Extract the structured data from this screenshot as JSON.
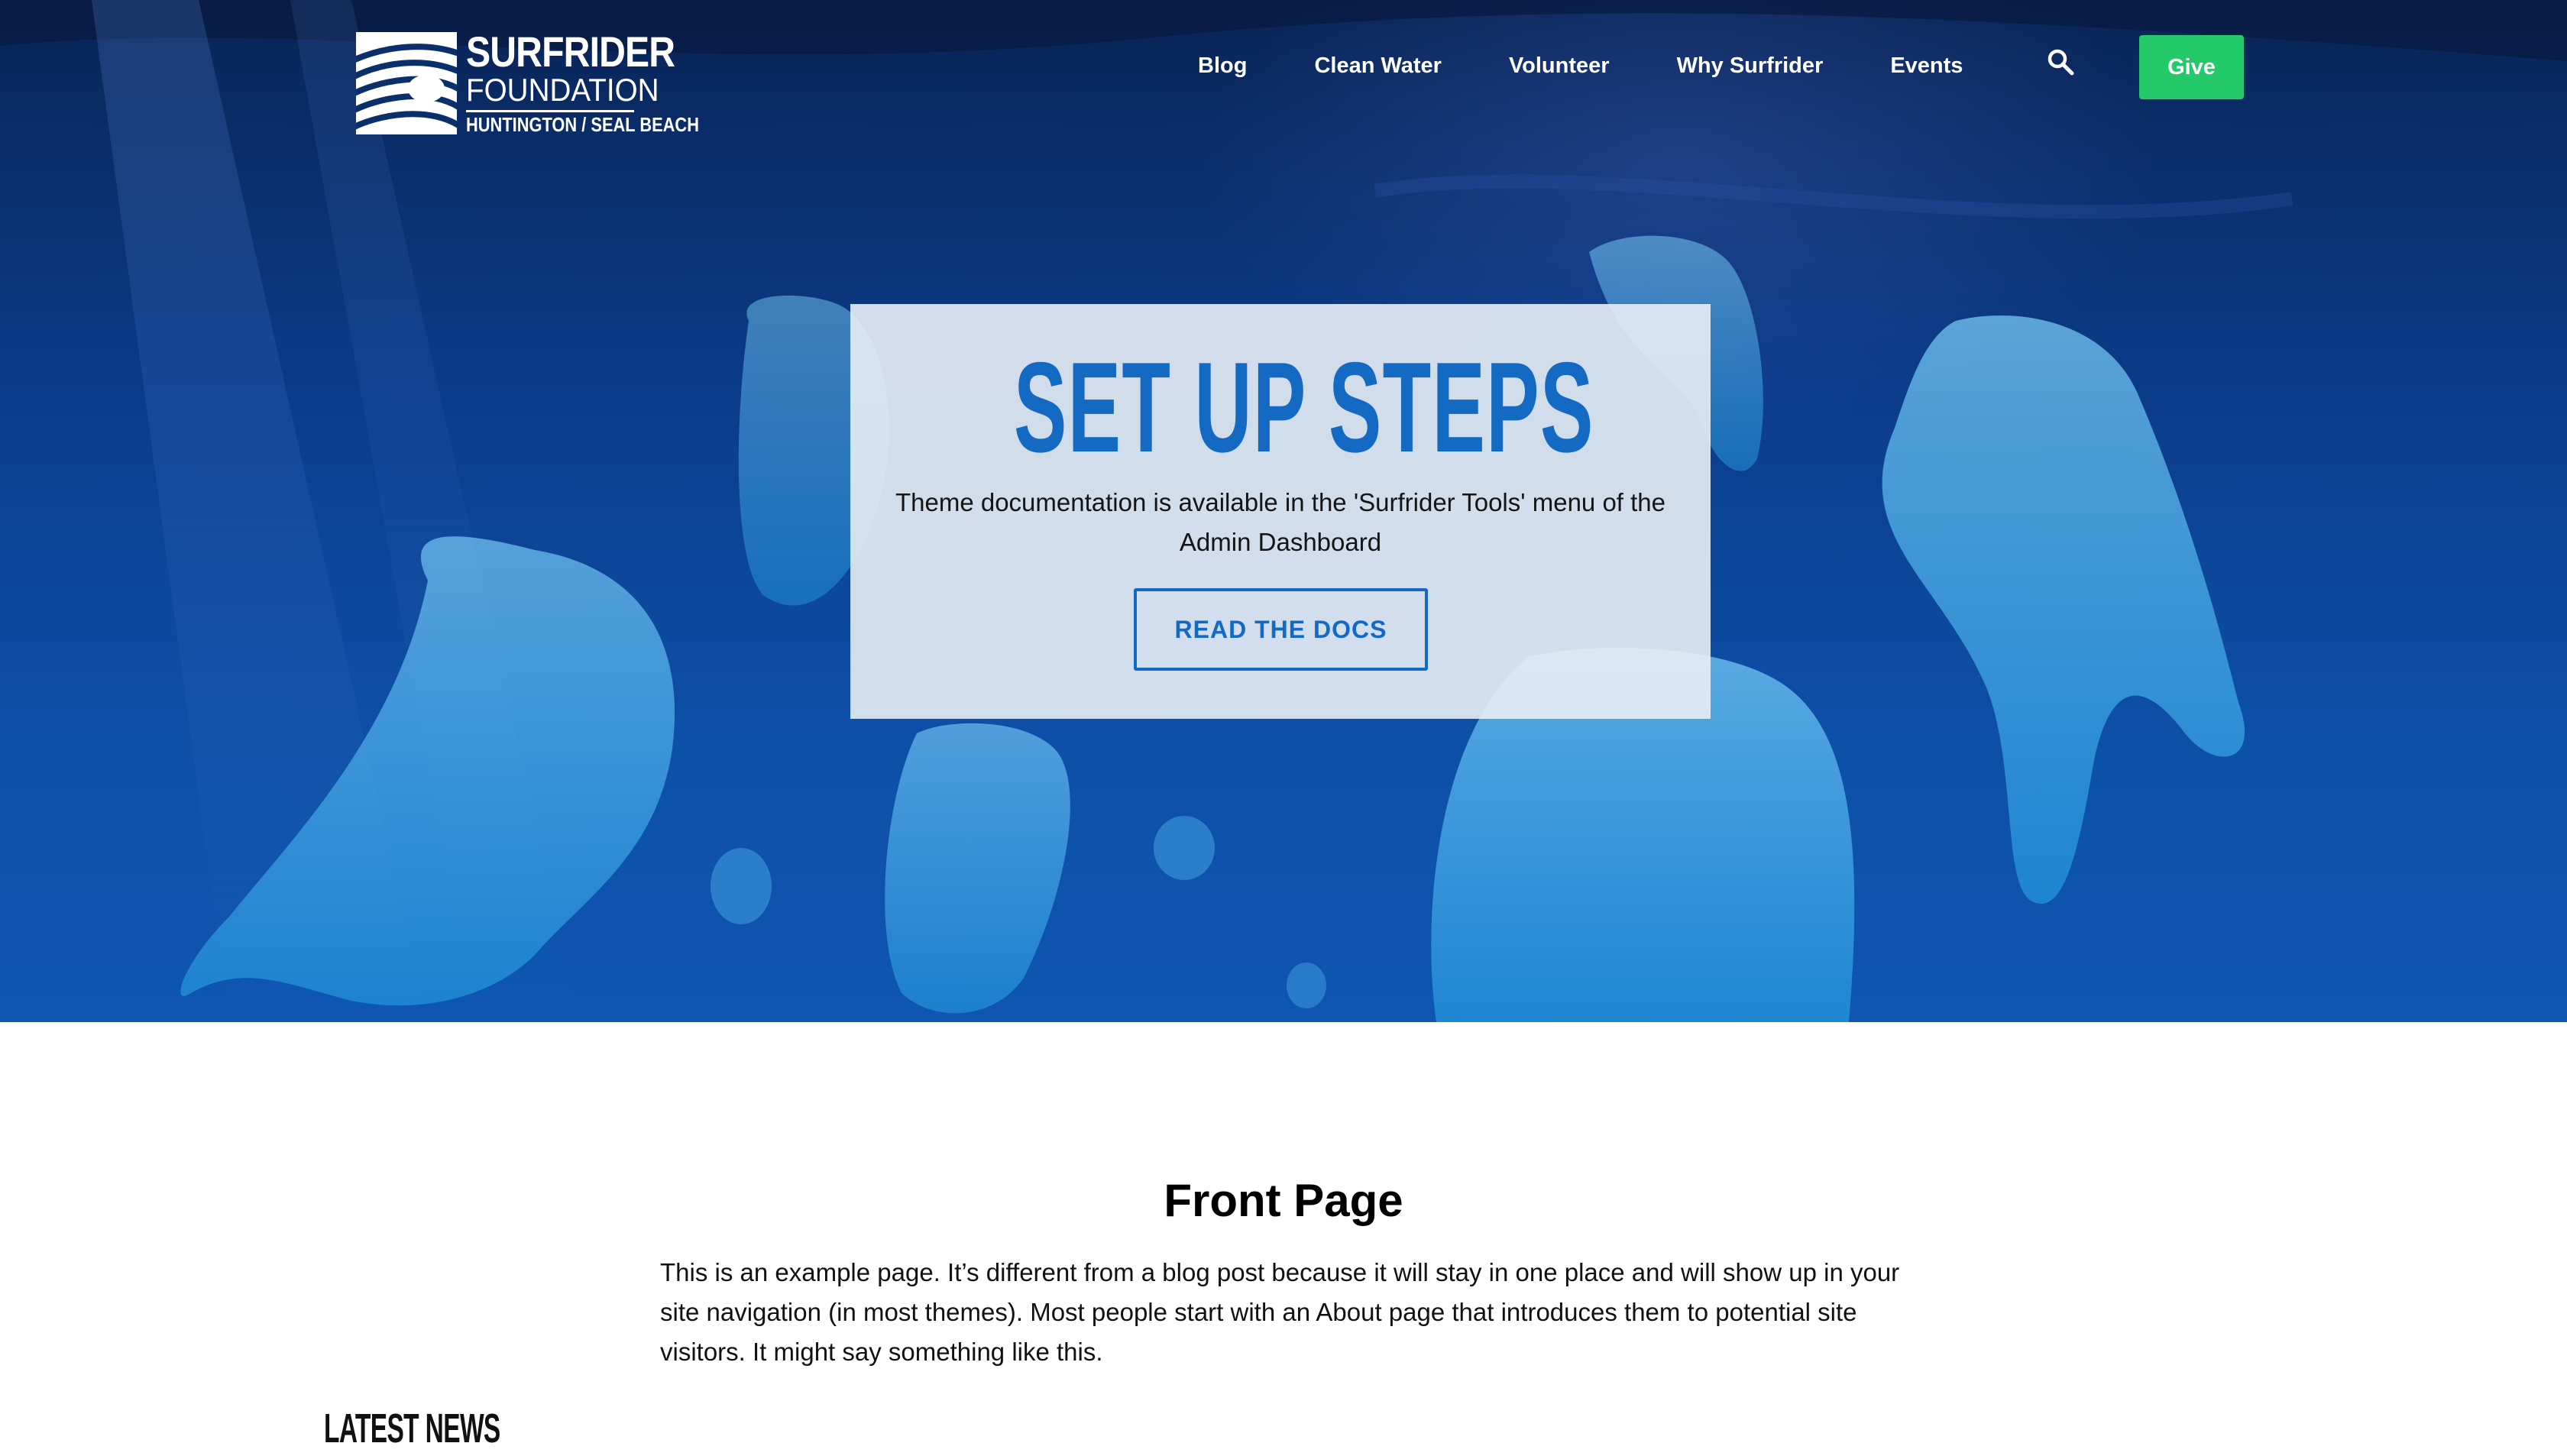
{
  "brand": {
    "name": "SURFRIDER",
    "subtitle": "FOUNDATION",
    "chapter": "HUNTINGTON / SEAL BEACH"
  },
  "nav": {
    "items": [
      "Blog",
      "Clean Water",
      "Volunteer",
      "Why Surfrider",
      "Events"
    ],
    "search_icon": "search-icon",
    "give_label": "Give"
  },
  "hero": {
    "title": "SET UP STEPS",
    "text": "Theme documentation is available in the 'Surfrider Tools' menu of the Admin Dashboard",
    "button_label": "READ THE DOCS"
  },
  "content": {
    "title": "Front Page",
    "body": "This is an example page. It’s different from a blog post because it will stay in one place and will show up in your site navigation (in most themes). Most people start with an About page that introduces them to potential site visitors. It might say something like this.",
    "section_heading": "LATEST NEWS"
  },
  "colors": {
    "accent_blue": "#1469c2",
    "give_green": "#24c96a",
    "hero_deep": "#0a2456"
  }
}
